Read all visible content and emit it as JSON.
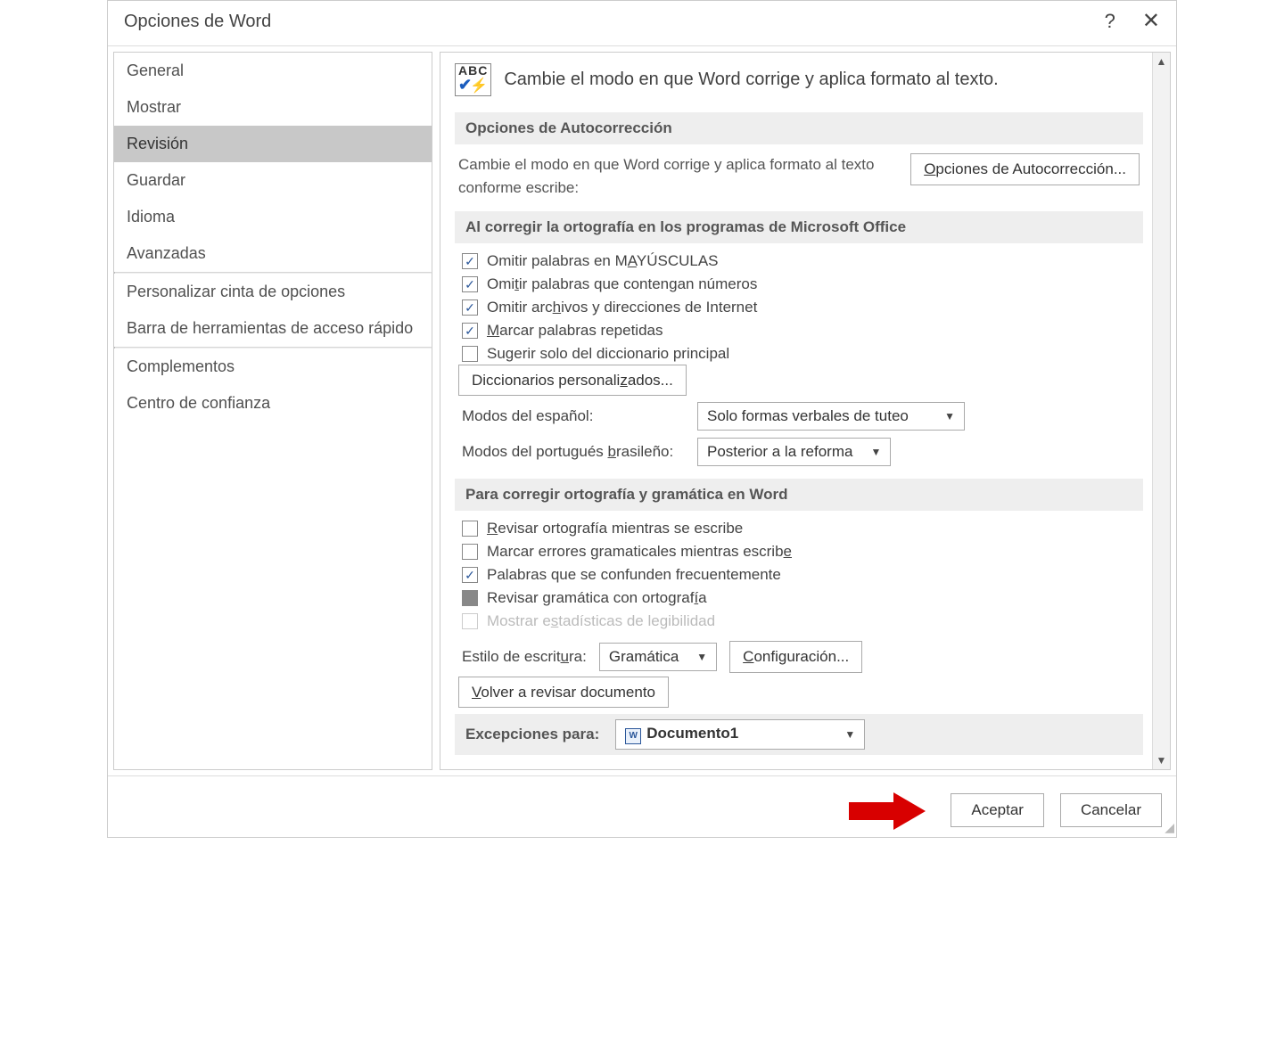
{
  "title": "Opciones de Word",
  "help_label": "?",
  "sidebar": {
    "items": [
      "General",
      "Mostrar",
      "Revisión",
      "Guardar",
      "Idioma",
      "Avanzadas",
      "Personalizar cinta de opciones",
      "Barra de herramientas de acceso rápido",
      "Complementos",
      "Centro de confianza"
    ],
    "selected_index": 2
  },
  "intro_text": "Cambie el modo en que Word corrige y aplica formato al texto.",
  "sec_autocorrect": {
    "header": "Opciones de Autocorrección",
    "desc": "Cambie el modo en que Word corrige y aplica formato al texto conforme escribe:",
    "button_prefix": "O",
    "button_rest": "pciones de Autocorrección..."
  },
  "sec_spellprog": {
    "header": "Al corregir la ortografía en los programas de Microsoft Office",
    "cb1_p1": "Omitir palabras en M",
    "cb1_u": "A",
    "cb1_p2": "YÚSCULAS",
    "cb2_p1": "Omi",
    "cb2_u": "t",
    "cb2_p2": "ir palabras que contengan números",
    "cb3_p1": "Omitir arc",
    "cb3_u": "h",
    "cb3_p2": "ivos y direcciones de Internet",
    "cb4_u": "M",
    "cb4_p2": "arcar palabras repetidas",
    "cb5": "Sugerir solo del diccionario principal",
    "dict_btn_p1": "Diccionarios personali",
    "dict_btn_u": "z",
    "dict_btn_p2": "ados...",
    "esp_label": "Modos del español:",
    "esp_value": "Solo formas verbales de tuteo",
    "por_label_p1": "Modos del portugués ",
    "por_label_u": "b",
    "por_label_p2": "rasileño:",
    "por_value": "Posterior a la reforma"
  },
  "sec_spellword": {
    "header": "Para corregir ortografía y gramática en Word",
    "cb1_u": "R",
    "cb1_p2": "evisar ortografía mientras se escribe",
    "cb2_p1": "Marcar errores gramaticales mientras escrib",
    "cb2_u": "e",
    "cb3": "Palabras que se confunden frecuentemente",
    "cb4_p1": "Revisar gramática con ortograf",
    "cb4_u": "í",
    "cb4_p2": "a",
    "cb5_p1": "Mostrar e",
    "cb5_u": "s",
    "cb5_p2": "tadísticas de legibilidad",
    "style_label_p1": "Estilo de escrit",
    "style_label_u": "u",
    "style_label_p2": "ra:",
    "style_value": "Gramática",
    "config_u": "C",
    "config_rest": "onfiguración...",
    "recheck_u": "V",
    "recheck_rest": "olver a revisar documento"
  },
  "sec_exceptions": {
    "label": "Excepciones para:",
    "doc_value": "Documento1"
  },
  "footer": {
    "ok": "Aceptar",
    "cancel": "Cancelar"
  }
}
